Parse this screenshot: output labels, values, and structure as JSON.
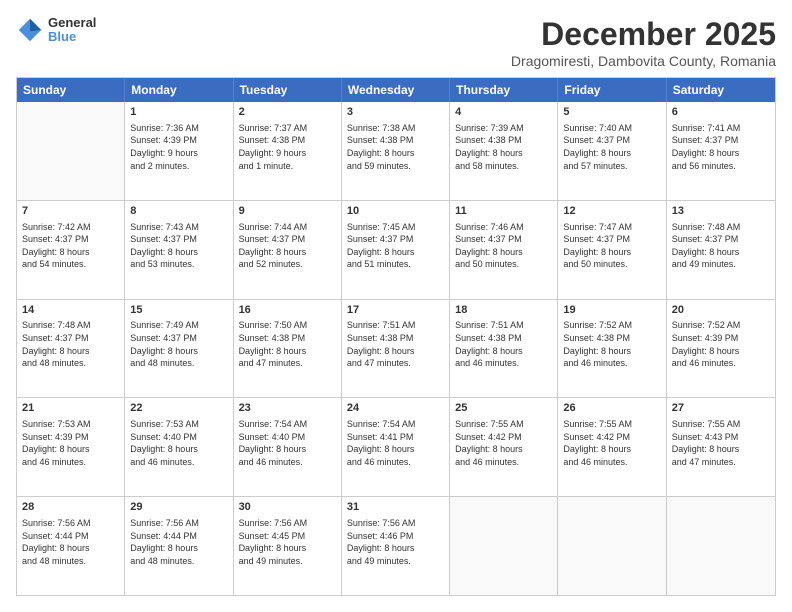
{
  "logo": {
    "line1": "General",
    "line2": "Blue"
  },
  "title": "December 2025",
  "location": "Dragomiresti, Dambovita County, Romania",
  "header_days": [
    "Sunday",
    "Monday",
    "Tuesday",
    "Wednesday",
    "Thursday",
    "Friday",
    "Saturday"
  ],
  "rows": [
    [
      {
        "day": "",
        "text": ""
      },
      {
        "day": "1",
        "text": "Sunrise: 7:36 AM\nSunset: 4:39 PM\nDaylight: 9 hours\nand 2 minutes."
      },
      {
        "day": "2",
        "text": "Sunrise: 7:37 AM\nSunset: 4:38 PM\nDaylight: 9 hours\nand 1 minute."
      },
      {
        "day": "3",
        "text": "Sunrise: 7:38 AM\nSunset: 4:38 PM\nDaylight: 8 hours\nand 59 minutes."
      },
      {
        "day": "4",
        "text": "Sunrise: 7:39 AM\nSunset: 4:38 PM\nDaylight: 8 hours\nand 58 minutes."
      },
      {
        "day": "5",
        "text": "Sunrise: 7:40 AM\nSunset: 4:37 PM\nDaylight: 8 hours\nand 57 minutes."
      },
      {
        "day": "6",
        "text": "Sunrise: 7:41 AM\nSunset: 4:37 PM\nDaylight: 8 hours\nand 56 minutes."
      }
    ],
    [
      {
        "day": "7",
        "text": "Sunrise: 7:42 AM\nSunset: 4:37 PM\nDaylight: 8 hours\nand 54 minutes."
      },
      {
        "day": "8",
        "text": "Sunrise: 7:43 AM\nSunset: 4:37 PM\nDaylight: 8 hours\nand 53 minutes."
      },
      {
        "day": "9",
        "text": "Sunrise: 7:44 AM\nSunset: 4:37 PM\nDaylight: 8 hours\nand 52 minutes."
      },
      {
        "day": "10",
        "text": "Sunrise: 7:45 AM\nSunset: 4:37 PM\nDaylight: 8 hours\nand 51 minutes."
      },
      {
        "day": "11",
        "text": "Sunrise: 7:46 AM\nSunset: 4:37 PM\nDaylight: 8 hours\nand 50 minutes."
      },
      {
        "day": "12",
        "text": "Sunrise: 7:47 AM\nSunset: 4:37 PM\nDaylight: 8 hours\nand 50 minutes."
      },
      {
        "day": "13",
        "text": "Sunrise: 7:48 AM\nSunset: 4:37 PM\nDaylight: 8 hours\nand 49 minutes."
      }
    ],
    [
      {
        "day": "14",
        "text": "Sunrise: 7:48 AM\nSunset: 4:37 PM\nDaylight: 8 hours\nand 48 minutes."
      },
      {
        "day": "15",
        "text": "Sunrise: 7:49 AM\nSunset: 4:37 PM\nDaylight: 8 hours\nand 48 minutes."
      },
      {
        "day": "16",
        "text": "Sunrise: 7:50 AM\nSunset: 4:38 PM\nDaylight: 8 hours\nand 47 minutes."
      },
      {
        "day": "17",
        "text": "Sunrise: 7:51 AM\nSunset: 4:38 PM\nDaylight: 8 hours\nand 47 minutes."
      },
      {
        "day": "18",
        "text": "Sunrise: 7:51 AM\nSunset: 4:38 PM\nDaylight: 8 hours\nand 46 minutes."
      },
      {
        "day": "19",
        "text": "Sunrise: 7:52 AM\nSunset: 4:38 PM\nDaylight: 8 hours\nand 46 minutes."
      },
      {
        "day": "20",
        "text": "Sunrise: 7:52 AM\nSunset: 4:39 PM\nDaylight: 8 hours\nand 46 minutes."
      }
    ],
    [
      {
        "day": "21",
        "text": "Sunrise: 7:53 AM\nSunset: 4:39 PM\nDaylight: 8 hours\nand 46 minutes."
      },
      {
        "day": "22",
        "text": "Sunrise: 7:53 AM\nSunset: 4:40 PM\nDaylight: 8 hours\nand 46 minutes."
      },
      {
        "day": "23",
        "text": "Sunrise: 7:54 AM\nSunset: 4:40 PM\nDaylight: 8 hours\nand 46 minutes."
      },
      {
        "day": "24",
        "text": "Sunrise: 7:54 AM\nSunset: 4:41 PM\nDaylight: 8 hours\nand 46 minutes."
      },
      {
        "day": "25",
        "text": "Sunrise: 7:55 AM\nSunset: 4:42 PM\nDaylight: 8 hours\nand 46 minutes."
      },
      {
        "day": "26",
        "text": "Sunrise: 7:55 AM\nSunset: 4:42 PM\nDaylight: 8 hours\nand 46 minutes."
      },
      {
        "day": "27",
        "text": "Sunrise: 7:55 AM\nSunset: 4:43 PM\nDaylight: 8 hours\nand 47 minutes."
      }
    ],
    [
      {
        "day": "28",
        "text": "Sunrise: 7:56 AM\nSunset: 4:44 PM\nDaylight: 8 hours\nand 48 minutes."
      },
      {
        "day": "29",
        "text": "Sunrise: 7:56 AM\nSunset: 4:44 PM\nDaylight: 8 hours\nand 48 minutes."
      },
      {
        "day": "30",
        "text": "Sunrise: 7:56 AM\nSunset: 4:45 PM\nDaylight: 8 hours\nand 49 minutes."
      },
      {
        "day": "31",
        "text": "Sunrise: 7:56 AM\nSunset: 4:46 PM\nDaylight: 8 hours\nand 49 minutes."
      },
      {
        "day": "",
        "text": ""
      },
      {
        "day": "",
        "text": ""
      },
      {
        "day": "",
        "text": ""
      }
    ]
  ]
}
